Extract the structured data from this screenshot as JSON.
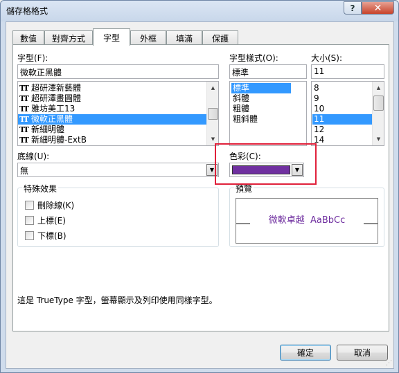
{
  "window": {
    "title": "儲存格格式",
    "help_label": "?",
    "close_label": "✕"
  },
  "tabs": [
    {
      "label": "數值",
      "active": false
    },
    {
      "label": "對齊方式",
      "active": false
    },
    {
      "label": "字型",
      "active": true
    },
    {
      "label": "外框",
      "active": false
    },
    {
      "label": "填滿",
      "active": false
    },
    {
      "label": "保護",
      "active": false
    }
  ],
  "font": {
    "label": "字型(F):",
    "value": "微軟正黑體",
    "list": [
      {
        "label": "超研澤新藝體",
        "icon": "truetype-icon",
        "selected": false
      },
      {
        "label": "超研澤畫圓體",
        "icon": "truetype-icon",
        "selected": false
      },
      {
        "label": "雅坊美工13",
        "icon": "truetype-icon",
        "selected": false
      },
      {
        "label": "微軟正黑體",
        "icon": "truetype-icon",
        "selected": true
      },
      {
        "label": "新細明體",
        "icon": "truetype-icon",
        "selected": false
      },
      {
        "label": "新細明體-ExtB",
        "icon": "truetype-icon",
        "selected": false
      }
    ]
  },
  "style": {
    "label": "字型樣式(O):",
    "value": "標準",
    "list": [
      {
        "label": "標準",
        "selected": true
      },
      {
        "label": "斜體",
        "selected": false
      },
      {
        "label": "粗體",
        "selected": false
      },
      {
        "label": "粗斜體",
        "selected": false
      }
    ]
  },
  "size": {
    "label": "大小(S):",
    "value": "11",
    "list": [
      {
        "label": "8",
        "selected": false
      },
      {
        "label": "9",
        "selected": false
      },
      {
        "label": "10",
        "selected": false
      },
      {
        "label": "11",
        "selected": true
      },
      {
        "label": "12",
        "selected": false
      },
      {
        "label": "14",
        "selected": false
      }
    ]
  },
  "underline": {
    "label": "底線(U):",
    "value": "無"
  },
  "color": {
    "label": "色彩(C):",
    "swatch": "#7030a0"
  },
  "effects": {
    "title": "特殊效果",
    "items": [
      {
        "label": "刪除線(K)",
        "checked": false
      },
      {
        "label": "上標(E)",
        "checked": false
      },
      {
        "label": "下標(B)",
        "checked": false
      }
    ]
  },
  "preview": {
    "title": "預覽",
    "sample": "微軟卓越  AaBbCc",
    "sample_color": "#7030a0"
  },
  "info_text": "這是 TrueType 字型，螢幕顯示及列印使用同樣字型。",
  "buttons": {
    "ok": "確定",
    "cancel": "取消"
  },
  "highlight_color": "#e0203a"
}
